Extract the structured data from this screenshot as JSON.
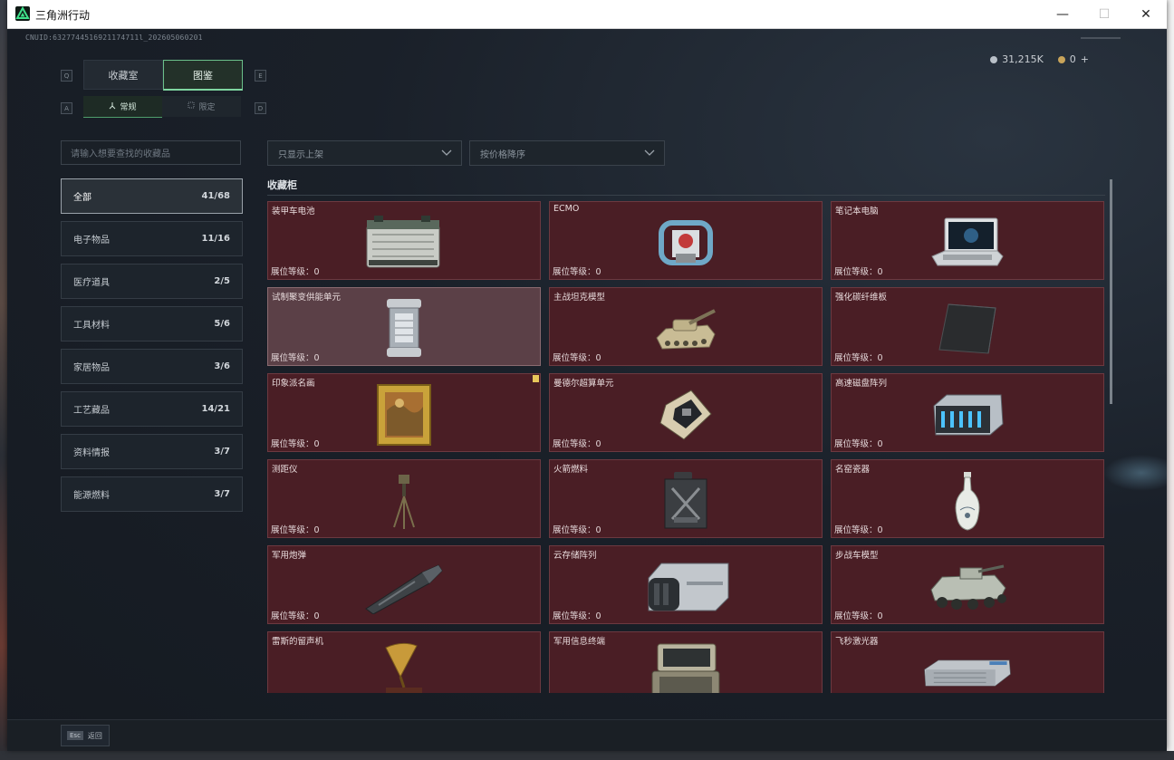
{
  "window": {
    "title": "三角洲行动",
    "minimize_icon": "minimize-icon",
    "maximize_icon": "maximize-icon",
    "close_icon": "close-icon"
  },
  "uid_text": "CNUID:6327744516921174711l_202605060201",
  "keyhints": {
    "prev_tab": "Q",
    "next_tab": "E",
    "prev_sub": "A",
    "next_sub": "D"
  },
  "tabs": [
    {
      "label": "收藏室",
      "active": false
    },
    {
      "label": "图鉴",
      "active": true
    }
  ],
  "subtabs": [
    {
      "label": "常规",
      "icon": "tripod-icon",
      "active": true
    },
    {
      "label": "限定",
      "icon": "sparkle-icon",
      "active": false
    }
  ],
  "currency": [
    {
      "value": "31,215K",
      "color": "#b9c0c8"
    },
    {
      "value": "0",
      "color": "#c8a45a"
    }
  ],
  "currency_add": "+",
  "search": {
    "placeholder": "请输入想要查找的收藏品"
  },
  "filters": {
    "shelf": "只显示上架",
    "sort": "按价格降序"
  },
  "categories": [
    {
      "label": "全部",
      "count": "41/68",
      "active": true
    },
    {
      "label": "电子物品",
      "count": "11/16"
    },
    {
      "label": "医疗道具",
      "count": "2/5"
    },
    {
      "label": "工具材料",
      "count": "5/6"
    },
    {
      "label": "家居物品",
      "count": "3/6"
    },
    {
      "label": "工艺藏品",
      "count": "14/21"
    },
    {
      "label": "资料情报",
      "count": "3/7"
    },
    {
      "label": "能源燃料",
      "count": "3/7"
    }
  ],
  "section_title": "收藏柜",
  "level_label": "展位等级：0",
  "items": [
    {
      "name": "装甲车电池",
      "icon": "battery-icon"
    },
    {
      "name": "ECMO",
      "icon": "ecmo-icon"
    },
    {
      "name": "笔记本电脑",
      "icon": "laptop-icon"
    },
    {
      "name": "试制聚变供能单元",
      "icon": "fusion-cell-icon",
      "highlight": true
    },
    {
      "name": "主战坦克模型",
      "icon": "tank-icon"
    },
    {
      "name": "强化碳纤维板",
      "icon": "carbon-plate-icon"
    },
    {
      "name": "印象派名画",
      "icon": "painting-icon",
      "badge": true
    },
    {
      "name": "曼德尔超算单元",
      "icon": "chip-icon"
    },
    {
      "name": "高速磁盘阵列",
      "icon": "disk-array-icon"
    },
    {
      "name": "测距仪",
      "icon": "rangefinder-icon"
    },
    {
      "name": "火箭燃料",
      "icon": "fuel-can-icon"
    },
    {
      "name": "名窑瓷器",
      "icon": "vase-icon"
    },
    {
      "name": "军用炮弹",
      "icon": "shell-icon"
    },
    {
      "name": "云存储阵列",
      "icon": "storage-array-icon"
    },
    {
      "name": "步战车模型",
      "icon": "ifv-icon"
    },
    {
      "name": "雷斯的留声机",
      "icon": "gramophone-icon"
    },
    {
      "name": "军用信息终端",
      "icon": "terminal-icon"
    },
    {
      "name": "飞秒激光器",
      "icon": "laser-icon"
    }
  ],
  "footer": {
    "esc_key": "Esc",
    "esc_label": "返回"
  }
}
